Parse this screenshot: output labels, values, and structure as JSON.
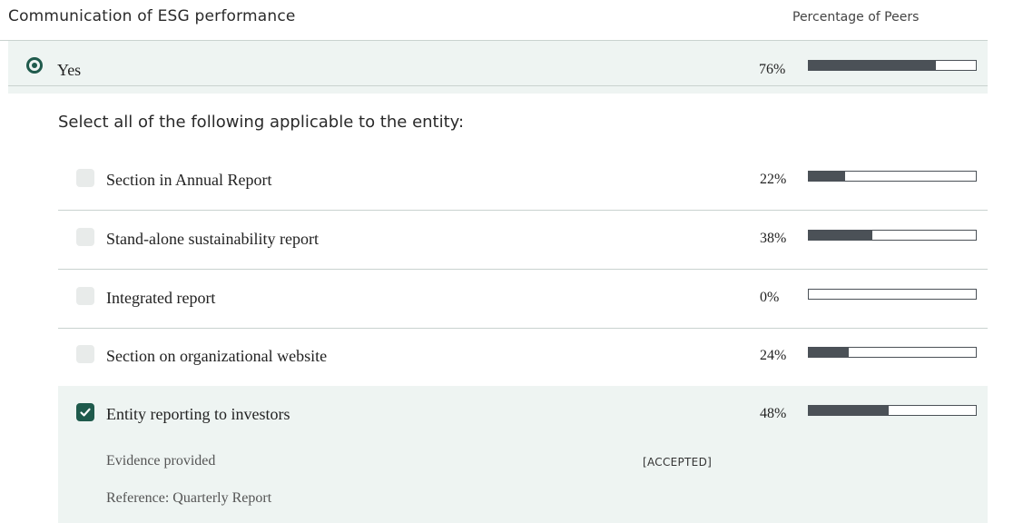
{
  "header": {
    "title": "Communication of ESG performance",
    "peers_label": "Percentage of Peers"
  },
  "answer": {
    "label": "Yes",
    "selected": true,
    "percent_label": "76%",
    "percent": 76
  },
  "select_title": "Select all of the following applicable to the entity:",
  "options": [
    {
      "label": "Section in Annual Report",
      "checked": false,
      "percent_label": "22%",
      "percent": 22
    },
    {
      "label": "Stand-alone sustainability report",
      "checked": false,
      "percent_label": "38%",
      "percent": 38
    },
    {
      "label": "Integrated report",
      "checked": false,
      "percent_label": "0%",
      "percent": 0
    },
    {
      "label": "Section on organizational website",
      "checked": false,
      "percent_label": "24%",
      "percent": 24
    },
    {
      "label": "Entity reporting to investors",
      "checked": true,
      "percent_label": "48%",
      "percent": 48,
      "evidence_label": "Evidence provided",
      "evidence_status": "[ACCEPTED]",
      "reference": "Reference: Quarterly Report"
    }
  ],
  "colors": {
    "accent": "#1f5a4c",
    "bar_fill": "#4b5157",
    "highlight_bg": "#eef4f2"
  },
  "icons": {
    "radio": "radio-selected-icon",
    "checkbox_checked": "checkmark-icon"
  }
}
